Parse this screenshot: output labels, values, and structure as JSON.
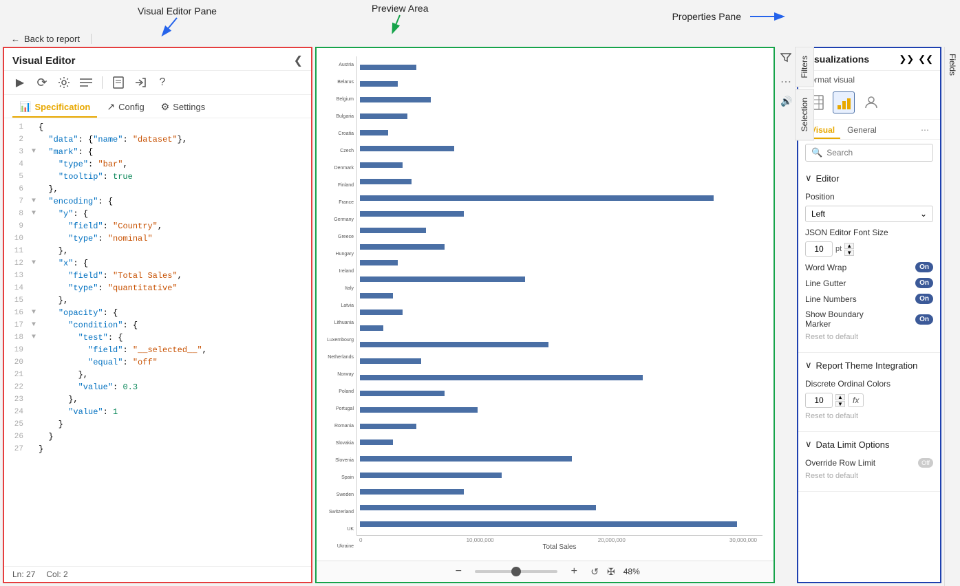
{
  "annotations": {
    "visual_editor_label": "Visual Editor Pane",
    "preview_label": "Preview Area",
    "properties_label": "Properties Pane"
  },
  "back_button": "Back to report",
  "visual_editor": {
    "title": "Visual Editor",
    "toolbar": {
      "run": "▶",
      "refresh": "↻",
      "wrench": "🔧",
      "format": "⟺",
      "file": "📄",
      "share": "↗",
      "help": "?"
    },
    "tabs": [
      {
        "id": "specification",
        "label": "Specification",
        "active": true,
        "icon": "📊"
      },
      {
        "id": "config",
        "label": "Config",
        "active": false,
        "icon": "↗"
      },
      {
        "id": "settings",
        "label": "Settings",
        "active": false,
        "icon": "⚙"
      }
    ],
    "code_lines": [
      {
        "num": 1,
        "fold": "",
        "content": "{"
      },
      {
        "num": 2,
        "fold": "",
        "content": "  \"data\": {\"name\": \"dataset\"},"
      },
      {
        "num": 3,
        "fold": "▼",
        "content": "  \"mark\": {"
      },
      {
        "num": 4,
        "fold": "",
        "content": "    \"type\": \"bar\","
      },
      {
        "num": 5,
        "fold": "",
        "content": "    \"tooltip\": true"
      },
      {
        "num": 6,
        "fold": "",
        "content": "  },"
      },
      {
        "num": 7,
        "fold": "▼",
        "content": "  \"encoding\": {"
      },
      {
        "num": 8,
        "fold": "▼",
        "content": "    \"y\": {"
      },
      {
        "num": 9,
        "fold": "",
        "content": "      \"field\": \"Country\","
      },
      {
        "num": 10,
        "fold": "",
        "content": "      \"type\": \"nominal\""
      },
      {
        "num": 11,
        "fold": "",
        "content": "    },"
      },
      {
        "num": 12,
        "fold": "▼",
        "content": "    \"x\": {"
      },
      {
        "num": 13,
        "fold": "",
        "content": "      \"field\": \"Total Sales\","
      },
      {
        "num": 14,
        "fold": "",
        "content": "      \"type\": \"quantitative\""
      },
      {
        "num": 15,
        "fold": "",
        "content": "    },"
      },
      {
        "num": 16,
        "fold": "▼",
        "content": "    \"opacity\": {"
      },
      {
        "num": 17,
        "fold": "▼",
        "content": "      \"condition\": {"
      },
      {
        "num": 18,
        "fold": "▼",
        "content": "        \"test\": {"
      },
      {
        "num": 19,
        "fold": "",
        "content": "          \"field\": \"__selected__\","
      },
      {
        "num": 20,
        "fold": "",
        "content": "          \"equal\": \"off\""
      },
      {
        "num": 21,
        "fold": "",
        "content": "        },"
      },
      {
        "num": 22,
        "fold": "",
        "content": "        \"value\": 0.3"
      },
      {
        "num": 23,
        "fold": "",
        "content": "      },"
      },
      {
        "num": 24,
        "fold": "",
        "content": "      \"value\": 1"
      },
      {
        "num": 25,
        "fold": "",
        "content": "    }"
      },
      {
        "num": 26,
        "fold": "",
        "content": "  }"
      },
      {
        "num": 27,
        "fold": "",
        "content": "}"
      }
    ],
    "status": {
      "ln": "Ln: 27",
      "col": "Col: 2"
    }
  },
  "preview": {
    "y_labels": [
      "Austria",
      "Belarus",
      "Belgium",
      "Bulgaria",
      "Croatia",
      "Czech",
      "Denmark",
      "Finland",
      "France",
      "Germany",
      "Greece",
      "Hungary",
      "Ireland",
      "Italy",
      "Latvia",
      "Lithuania",
      "Luxembourg",
      "Netherlands",
      "Norway",
      "Poland",
      "Portugal",
      "Romania",
      "Slovakia",
      "Slovenia",
      "Spain",
      "Sweden",
      "Switzerland",
      "UK",
      "Ukraine"
    ],
    "x_labels": [
      "0",
      "10,000,000",
      "20,000,000",
      "30,000,000"
    ],
    "x_axis_label": "Total Sales",
    "bars": [
      12,
      8,
      15,
      10,
      6,
      20,
      9,
      11,
      75,
      22,
      14,
      18,
      8,
      35,
      7,
      9,
      5,
      40,
      13,
      60,
      18,
      25,
      12,
      7,
      45,
      30,
      22,
      50,
      80
    ],
    "zoom": {
      "minus": "−",
      "plus": "+",
      "pct": "48%"
    }
  },
  "side_tabs": {
    "filters": "Filters",
    "selection": "Selection"
  },
  "visualizations": {
    "title": "Visualizations",
    "format_label": "Format visual",
    "tabs": [
      {
        "id": "visual",
        "label": "Visual",
        "active": true
      },
      {
        "id": "general",
        "label": "General",
        "active": false
      }
    ],
    "search_placeholder": "Search",
    "sections": {
      "editor": {
        "label": "Editor",
        "position_label": "Position",
        "position_value": "Left",
        "font_size_label": "JSON Editor Font Size",
        "font_size_value": "10",
        "font_size_unit": "pt",
        "word_wrap_label": "Word Wrap",
        "word_wrap_value": "On",
        "line_gutter_label": "Line Gutter",
        "line_gutter_value": "On",
        "line_numbers_label": "Line Numbers",
        "line_numbers_value": "On",
        "show_boundary_label": "Show Boundary",
        "show_boundary_label2": "Marker",
        "show_boundary_value": "On",
        "reset_label": "Reset to default"
      },
      "report_theme": {
        "label": "Report Theme Integration",
        "discrete_label": "Discrete Ordinal Colors",
        "discrete_value": "10",
        "reset_label": "Reset to default"
      },
      "data_limit": {
        "label": "Data Limit Options",
        "override_label": "Override Row Limit",
        "override_value": "Off",
        "reset_label": "Reset to default"
      }
    }
  },
  "fields_label": "Fields"
}
